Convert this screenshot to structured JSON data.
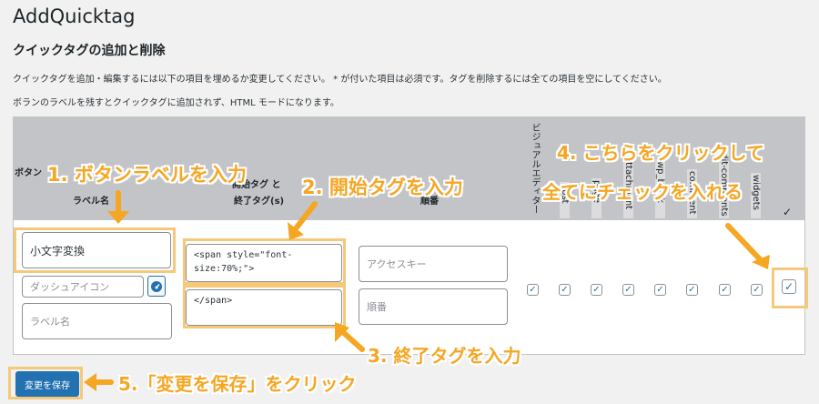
{
  "app_title": "AddQuicktag",
  "section_title": "クイックタグの追加と削除",
  "description_1": "クイックタグを追加・編集するには以下の項目を埋めるか変更してください。 * が付いた項目は必須です。タグを削除するには全ての項目を空にしてください。",
  "description_2": "ボランのラベルを残すとクイックタグに追加されず、HTML モードになります。",
  "table_header": {
    "button_label": "ボタン",
    "button_label_sub": "ラベル名",
    "tag_line1": "開始タグ と",
    "tag_line2": "終了タグ(s)",
    "order": "順番",
    "columns": [
      "ビジュアルエディター",
      "post",
      "page",
      "attachment",
      "wp_block",
      "comment",
      "edit-comments",
      "widgets"
    ],
    "select_all_symbol": "✓"
  },
  "form": {
    "label_name_value": "小文字変換",
    "dashicon_placeholder": "ダッシュアイコン",
    "label_placeholder": "ラベル名",
    "start_tag_value": "<span style=\"font-size:70%;\">",
    "end_tag_value": "</span>",
    "access_key_placeholder": "アクセスキー",
    "order_placeholder": "順番"
  },
  "checkboxes": {
    "states": [
      true,
      true,
      true,
      true,
      true,
      true,
      true,
      true,
      true
    ],
    "check_symbol": "✓"
  },
  "save_button": "変更を保存",
  "annotations": {
    "step1": "1. ボタンラベルを入力",
    "step2": "2. 開始タグを入力",
    "step3": "3. 終了タグを入力",
    "step4_line1": "4. こちらをクリックして",
    "step4_line2": "全てにチェックを入れる",
    "step5": "5.「変更を保存」をクリック"
  },
  "colors": {
    "accent": "#2271b1",
    "highlight": "#f6c87a",
    "annotation": "#f5a623",
    "header_bg": "#c3c4c7"
  }
}
